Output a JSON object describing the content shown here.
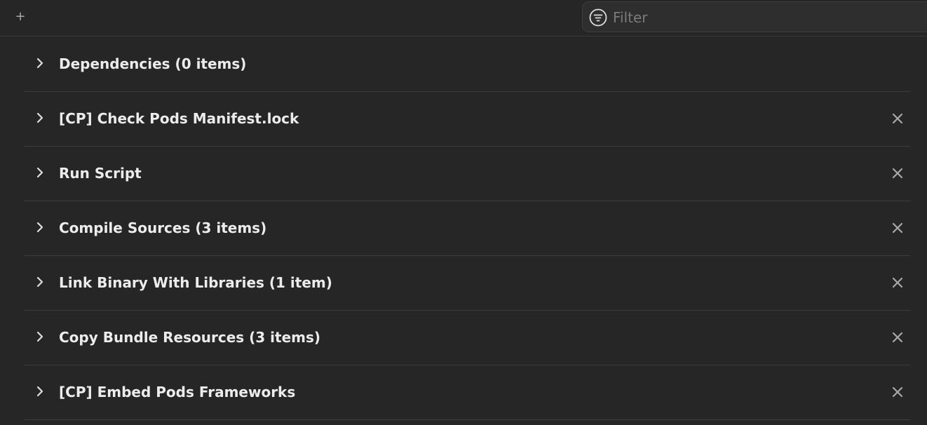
{
  "toolbar": {
    "add_label": "+",
    "add_icon": "plus-icon",
    "filter_icon": "filter-circle-icon",
    "filter_placeholder": "Filter",
    "filter_value": ""
  },
  "phases": [
    {
      "title": "Dependencies (0 items)",
      "deletable": false
    },
    {
      "title": "[CP] Check Pods Manifest.lock",
      "deletable": true
    },
    {
      "title": "Run Script",
      "deletable": true
    },
    {
      "title": "Compile Sources (3 items)",
      "deletable": true
    },
    {
      "title": "Link Binary With Libraries (1 item)",
      "deletable": true
    },
    {
      "title": "Copy Bundle Resources (3 items)",
      "deletable": true
    },
    {
      "title": "[CP] Embed Pods Frameworks",
      "deletable": true
    }
  ],
  "colors": {
    "background": "#262626",
    "divider": "#3c3c3c",
    "text": "#ececec",
    "icon": "#a8a8a8"
  }
}
